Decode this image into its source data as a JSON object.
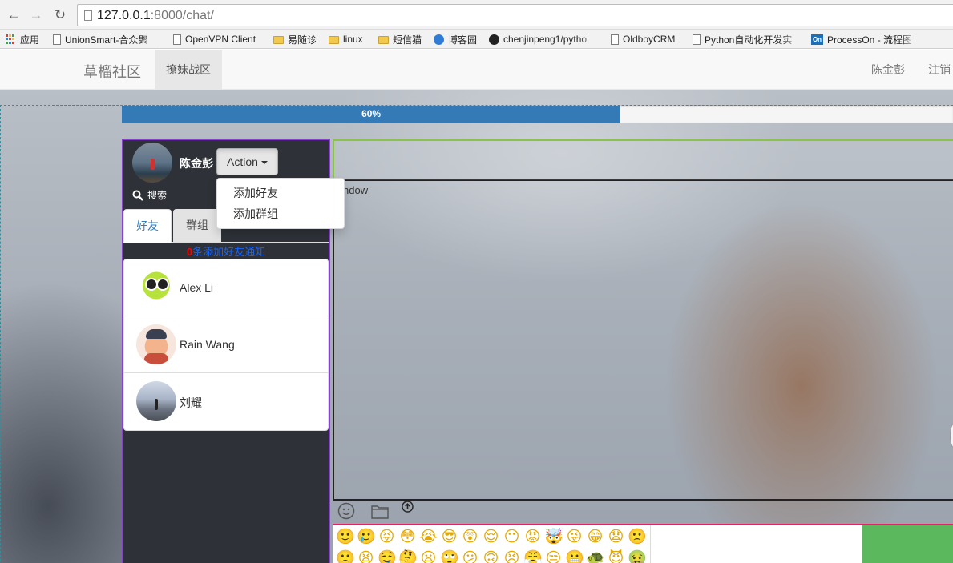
{
  "browser": {
    "url_host": "127.0.0.1",
    "url_rest": ":8000/chat/",
    "bookmarks": [
      {
        "label": "应用",
        "icon": "apps-icon"
      },
      {
        "label": "UnionSmart-合众聚",
        "icon": "page-icon"
      },
      {
        "label": "OpenVPN Client",
        "icon": "page-icon"
      },
      {
        "label": "易随诊",
        "icon": "folder-icon"
      },
      {
        "label": "linux",
        "icon": "folder-icon"
      },
      {
        "label": "短信猫",
        "icon": "folder-icon"
      },
      {
        "label": "博客园",
        "icon": "cnblogs-icon"
      },
      {
        "label": "chenjinpeng1/pytho",
        "icon": "github-icon"
      },
      {
        "label": "OldboyCRM",
        "icon": "page-icon"
      },
      {
        "label": "Python自动化开发实",
        "icon": "page-icon"
      },
      {
        "label": "ProcessOn - 流程图",
        "icon": "processon-icon"
      }
    ]
  },
  "navbar": {
    "brand": "草榴社区",
    "active_item": "撩妹战区",
    "user": "陈金彭",
    "logout": "注销"
  },
  "progress": {
    "label": "60%",
    "value_percent": 60
  },
  "sidebar": {
    "user_name": "陈金彭",
    "action_label": "Action",
    "dropdown": [
      "添加好友",
      "添加群组"
    ],
    "search_label": "搜索",
    "tabs": [
      {
        "label": "好友",
        "active": true
      },
      {
        "label": "群组",
        "active": false
      }
    ],
    "notice_count": "0",
    "notice_text": "条添加好友通知",
    "contacts": [
      {
        "name": "Alex Li",
        "avatar": "frog-avatar"
      },
      {
        "name": "Rain Wang",
        "avatar": "cartoon-avatar"
      },
      {
        "name": "刘耀",
        "avatar": "landscape-avatar"
      }
    ]
  },
  "chat": {
    "window_label": "ndow",
    "emoji_rows": [
      [
        "🙂",
        "🥲",
        "😝",
        "😳",
        "😭",
        "😎",
        "😲",
        "😌",
        "😶",
        "😡",
        "🤯",
        "😜",
        "😁",
        "😧",
        "🙁"
      ],
      [
        "🙁",
        "😫",
        "🤤",
        "🤔",
        "😦",
        "🙄",
        "😕",
        "🙃",
        "😣",
        "😤",
        "😒",
        "😬",
        "🐢",
        "😈",
        "🤢"
      ]
    ]
  },
  "colors": {
    "progress": "#337ab7",
    "panel_border": "#8a3fd1",
    "header_border": "#8bc34a",
    "input_border": "#e91e63",
    "send_button": "#5cb85c"
  }
}
